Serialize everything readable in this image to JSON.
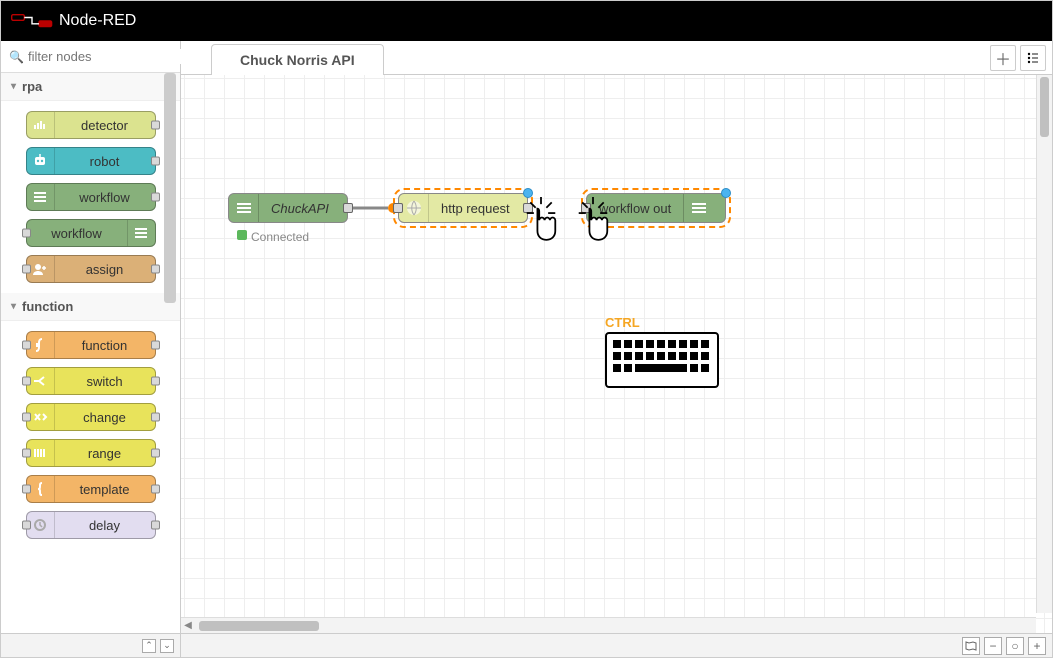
{
  "header": {
    "title": "Node-RED"
  },
  "palette": {
    "search_placeholder": "filter nodes",
    "categories": [
      {
        "name": "rpa",
        "nodes": [
          {
            "label": "detector",
            "color": "olive",
            "icon": "bars-icon",
            "port_in": false,
            "port_out": true
          },
          {
            "label": "robot",
            "color": "teal",
            "icon": "robot-icon",
            "port_in": false,
            "port_out": true
          },
          {
            "label": "workflow",
            "color": "green",
            "icon": "list-icon",
            "port_in": false,
            "port_out": true
          },
          {
            "label": "workflow",
            "color": "green",
            "icon": "list-icon",
            "port_in": true,
            "port_out": false,
            "icon_right": true
          },
          {
            "label": "assign",
            "color": "tan",
            "icon": "user-plus-icon",
            "port_in": true,
            "port_out": true
          }
        ]
      },
      {
        "name": "function",
        "nodes": [
          {
            "label": "function",
            "color": "orange",
            "icon": "fx-icon",
            "port_in": true,
            "port_out": true
          },
          {
            "label": "switch",
            "color": "yellow",
            "icon": "switch-icon",
            "port_in": true,
            "port_out": true
          },
          {
            "label": "change",
            "color": "yellow",
            "icon": "change-icon",
            "port_in": true,
            "port_out": true
          },
          {
            "label": "range",
            "color": "yellow",
            "icon": "range-icon",
            "port_in": true,
            "port_out": true
          },
          {
            "label": "template",
            "color": "orange",
            "icon": "brace-icon",
            "port_in": true,
            "port_out": true
          },
          {
            "label": "delay",
            "color": "lav",
            "icon": "clock-icon",
            "port_in": true,
            "port_out": true
          }
        ]
      }
    ]
  },
  "workspace": {
    "tab_label": "Chuck Norris API",
    "nodes": {
      "chuckapi": {
        "label": "ChuckAPI",
        "status_text": "Connected",
        "status_color": "#5cb85c"
      },
      "http": {
        "label": "http request"
      },
      "workflow_out": {
        "label": "workflow out"
      }
    },
    "overlay": {
      "keyboard_label": "CTRL"
    }
  },
  "colors": {
    "olive": "#dbe38f",
    "teal": "#4cbcc4",
    "green": "#87b07b",
    "tan": "#dbb077",
    "orange": "#f3b567",
    "yellow": "#e8e35b",
    "lav": "#e2ddf0",
    "http": "#e3e9a4"
  }
}
